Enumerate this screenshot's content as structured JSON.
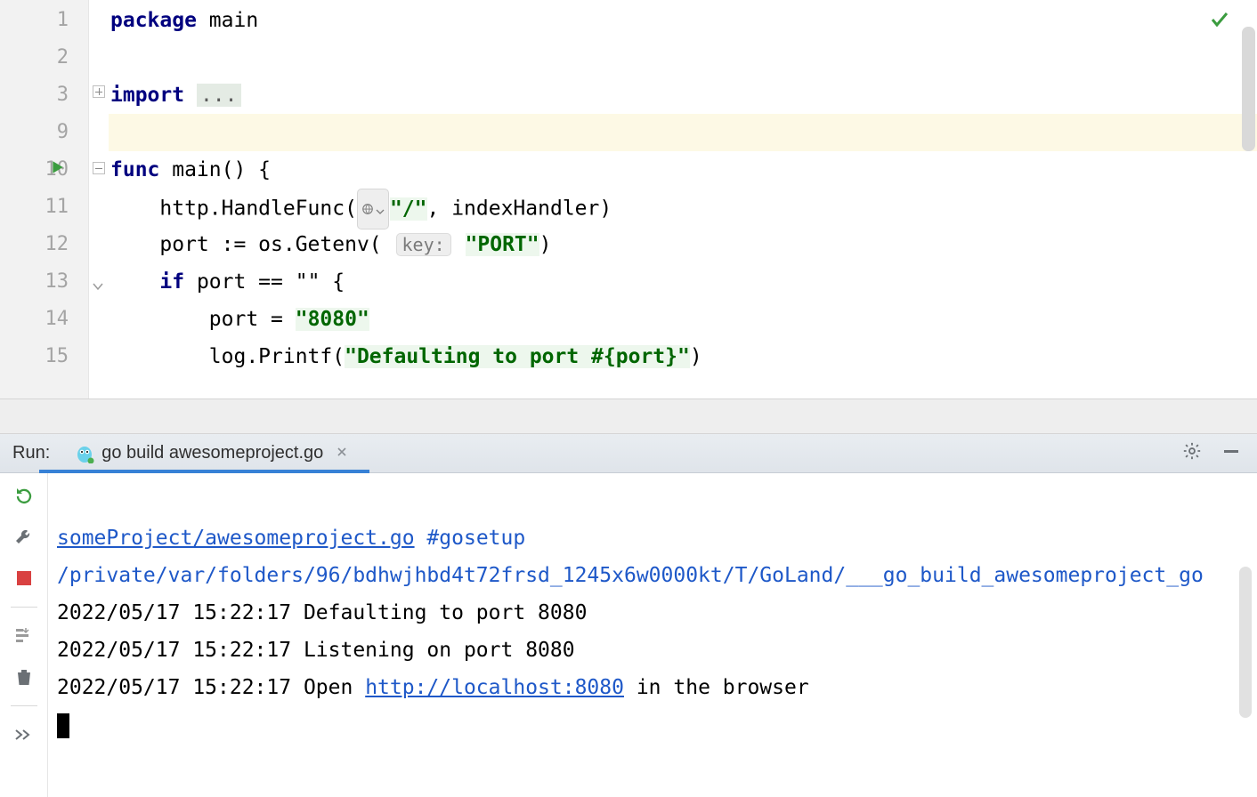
{
  "editor": {
    "lines": [
      {
        "num": "1"
      },
      {
        "num": "2"
      },
      {
        "num": "3"
      },
      {
        "num": "9"
      },
      {
        "num": "10"
      },
      {
        "num": "11"
      },
      {
        "num": "12"
      },
      {
        "num": "13"
      },
      {
        "num": "14"
      },
      {
        "num": "15"
      }
    ],
    "tokens": {
      "package_kw": "package",
      "package_name": " main",
      "import_kw": "import",
      "import_fold": "...",
      "func_kw": "func",
      "main_sig": " main() {",
      "l11_a": "    http.HandleFunc(",
      "l11_str": "\"/\"",
      "l11_b": ", indexHandler)",
      "l12_a": "    port := os.Getenv(",
      "l12_hint": "key:",
      "l12_str": "\"PORT\"",
      "l12_b": ")",
      "l13_if": "if",
      "l13_rest": " port == \"\" {",
      "l14_a": "        port = ",
      "l14_str": "\"8080\"",
      "l15_a": "        log.Printf(",
      "l15_str": "\"Defaulting to port #{port}\"",
      "l15_b": ")"
    }
  },
  "run": {
    "label": "Run:",
    "tab_title": "go build awesomeproject.go",
    "console": {
      "link1": "someProject/awesomeproject.go",
      "setup": " #gosetup",
      "path": "/private/var/folders/96/bdhwjhbd4t72frsd_1245x6w0000kt/T/GoLand/___go_build_awesomeproject_go",
      "log1": "2022/05/17 15:22:17 Defaulting to port 8080",
      "log2": "2022/05/17 15:22:17 Listening on port 8080",
      "log3_a": "2022/05/17 15:22:17 Open ",
      "log3_url": "http://localhost:8080",
      "log3_b": " in the browser"
    }
  }
}
